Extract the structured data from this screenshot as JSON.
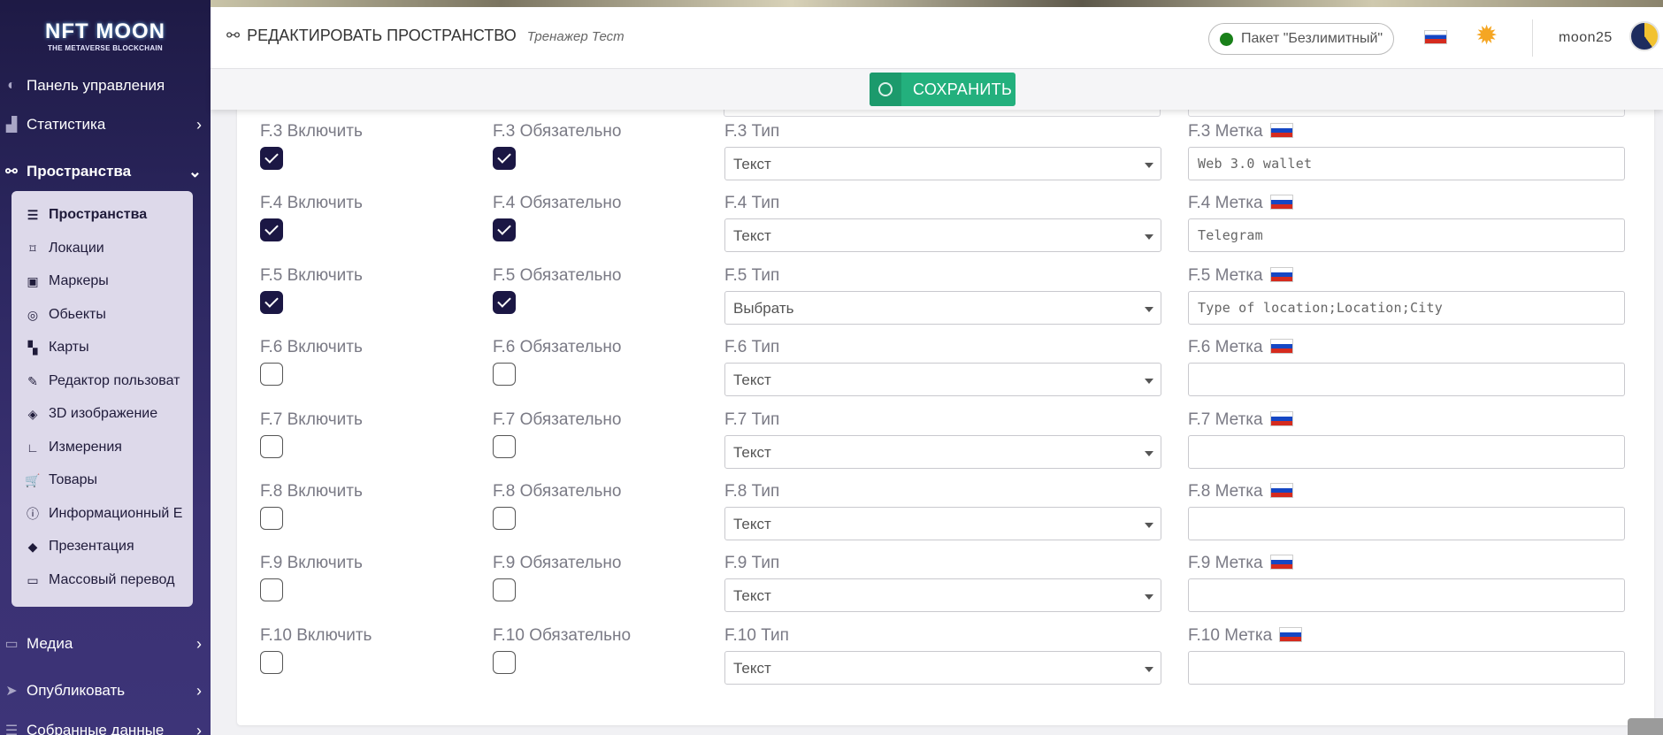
{
  "sidebar": {
    "logo": {
      "main": "NFT MOON",
      "sub": "THE METAVERSE BLOCKCHAIN"
    },
    "items": [
      {
        "label": "Панель управления",
        "icon": "dashboard-icon"
      },
      {
        "label": "Статистика",
        "icon": "chart-icon",
        "chevron": "›"
      },
      {
        "label": "Пространства",
        "icon": "spaces-icon",
        "chevron": "⌄"
      },
      {
        "label": "Медиа",
        "icon": "monitor-icon",
        "chevron": "›"
      },
      {
        "label": "Опубликовать",
        "icon": "send-icon",
        "chevron": "›"
      },
      {
        "label": "Собранные данные",
        "icon": "database-icon",
        "chevron": "›"
      }
    ],
    "submenu": [
      {
        "label": "Пространства",
        "icon": "list-icon"
      },
      {
        "label": "Локации",
        "icon": "location-icon"
      },
      {
        "label": "Маркеры",
        "icon": "image-icon"
      },
      {
        "label": "Обьекты",
        "icon": "target-icon"
      },
      {
        "label": "Карты",
        "icon": "map-icon"
      },
      {
        "label": "Редактор пользоват",
        "icon": "edit-icon"
      },
      {
        "label": "3D изображение",
        "icon": "cube-icon"
      },
      {
        "label": "Измерения",
        "icon": "ruler-icon"
      },
      {
        "label": "Товары",
        "icon": "cart-icon"
      },
      {
        "label": "Информационный Е",
        "icon": "info-icon"
      },
      {
        "label": "Презентация",
        "icon": "diamond-icon"
      },
      {
        "label": "Массовый перевод",
        "icon": "translate-icon"
      }
    ]
  },
  "header": {
    "title": "РЕДАКТИРОВАТЬ ПРОСТРАНСТВО",
    "subtitle": "Тренажер Тест",
    "package": "Пакет \"Безлимитный\"",
    "username": "moon25"
  },
  "toolbar": {
    "save_label": "СОХРАНИТЬ"
  },
  "fields": [
    {
      "include_label": "F.3 Включить",
      "required_label": "F.3 Обязательно",
      "type_label": "F.3 Тип",
      "mark_label": "F.3 Метка",
      "include": true,
      "required": true,
      "type": "Текст",
      "mark": "Web 3.0 wallet"
    },
    {
      "include_label": "F.4 Включить",
      "required_label": "F.4 Обязательно",
      "type_label": "F.4 Тип",
      "mark_label": "F.4 Метка",
      "include": true,
      "required": true,
      "type": "Текст",
      "mark": "Telegram"
    },
    {
      "include_label": "F.5 Включить",
      "required_label": "F.5 Обязательно",
      "type_label": "F.5 Тип",
      "mark_label": "F.5 Метка",
      "include": true,
      "required": true,
      "type": "Выбрать",
      "mark": "Type of location;Location;City"
    },
    {
      "include_label": "F.6 Включить",
      "required_label": "F.6 Обязательно",
      "type_label": "F.6 Тип",
      "mark_label": "F.6 Метка",
      "include": false,
      "required": false,
      "type": "Текст",
      "mark": ""
    },
    {
      "include_label": "F.7 Включить",
      "required_label": "F.7 Обязательно",
      "type_label": "F.7 Тип",
      "mark_label": "F.7 Метка",
      "include": false,
      "required": false,
      "type": "Текст",
      "mark": ""
    },
    {
      "include_label": "F.8 Включить",
      "required_label": "F.8 Обязательно",
      "type_label": "F.8 Тип",
      "mark_label": "F.8 Метка",
      "include": false,
      "required": false,
      "type": "Текст",
      "mark": ""
    },
    {
      "include_label": "F.9 Включить",
      "required_label": "F.9 Обязательно",
      "type_label": "F.9 Тип",
      "mark_label": "F.9 Метка",
      "include": false,
      "required": false,
      "type": "Текст",
      "mark": ""
    },
    {
      "include_label": "F.10 Включить",
      "required_label": "F.10 Обязательно",
      "type_label": "F.10 Тип",
      "mark_label": "F.10 Метка",
      "include": false,
      "required": false,
      "type": "Текст",
      "mark": ""
    }
  ],
  "colors": {
    "sidebar_bg": "#2c2760",
    "accent": "#23b07d",
    "checkbox_on": "#1b1744",
    "status_dot": "#198019"
  }
}
